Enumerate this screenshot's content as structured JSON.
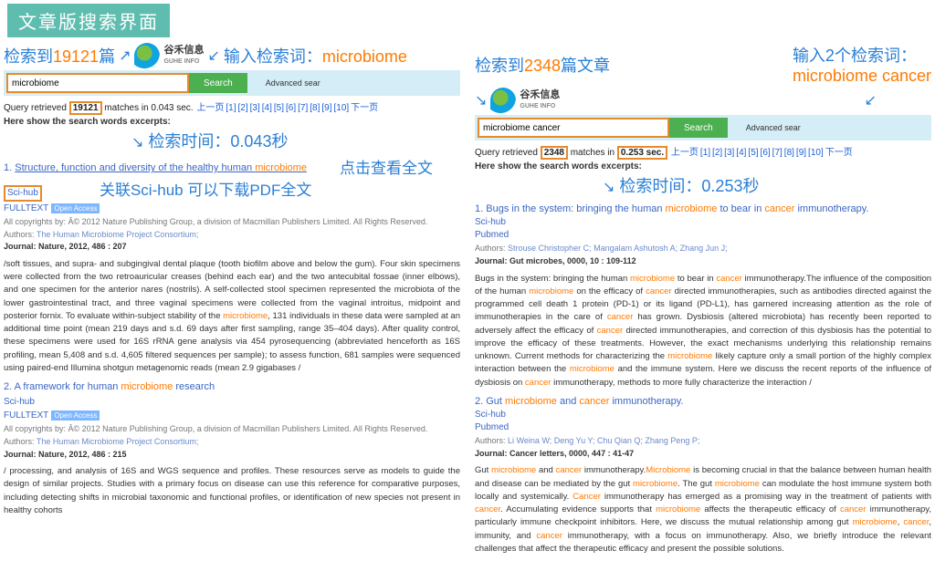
{
  "banner": "文章版搜索界面",
  "logo": {
    "cn": "谷禾信息",
    "en": "GUHE INFO"
  },
  "pagination_labels": {
    "prev": "上一页",
    "next": "下一页",
    "nums": [
      "[1]",
      "[2]",
      "[3]",
      "[4]",
      "[5]",
      "[6]",
      "[7]",
      "[8]",
      "[9]",
      "[10]"
    ]
  },
  "search_btn": "Search",
  "adv_search": "Advanced sear",
  "excerpt_head": "Here show the search words excerpts:",
  "left": {
    "anno_count_pre": "检索到",
    "count": "19121",
    "anno_count_suf": "篇",
    "anno_input": "输入检索词：",
    "query": "microbiome",
    "stat_pre": "Query retrieved ",
    "stat_mid": " matches in 0.043 sec.",
    "time_anno": "检索时间：0.043秒",
    "click_anno": "点击查看全文",
    "scihub_anno": "关联Sci-hub 可以下载PDF全文",
    "r1": {
      "num": "1.",
      "t1": "Structure, function and diversity of the healthy human ",
      "kw": "microbiome",
      "scihub": "Sci-hub",
      "ft": "FULLTEXT",
      "oa": "Open Access",
      "copy": "All copyrights by: Â© 2012 Nature Publishing Group, a division of Macmillan Publishers Limited. All Rights Reserved.",
      "auth_lbl": "Authors: ",
      "auth": "The Human Microbiome Project Consortium;",
      "jrn": "Journal: Nature, 2012, 486 : 207",
      "abs_a": "/soft tissues, and supra- and subgingival dental plaque (tooth biofilm above and below the gum). Four skin specimens were collected from the two retroauricular creases (behind each ear) and the two antecubital fossae (inner elbows), and one specimen for the anterior nares (nostrils). A self-collected stool specimen represented the microbiota of the lower gastrointestinal tract, and three vaginal specimens were collected from the vaginal introitus, midpoint and posterior fornix. To evaluate within-subject stability of the ",
      "abs_b": ", 131 individuals in these data were sampled at an additional time point (mean 219 days and s.d. 69 days after first sampling, range 35–404 days). After quality control, these specimens were used for 16S rRNA gene analysis via 454 pyrosequencing (abbreviated henceforth as 16S profiling, mean 5,408 and s.d. 4,605 filtered sequences per sample); to assess function, 681 samples were sequenced using paired-end Illumina shotgun metagenomic reads (mean 2.9 gigabases /"
    },
    "r2": {
      "num": "2.",
      "t1": "A framework for human ",
      "kw": "microbiome",
      "t2": " research",
      "scihub": "Sci-hub",
      "ft": "FULLTEXT",
      "oa": "Open Access",
      "copy": "All copyrights by: Â© 2012 Nature Publishing Group, a division of Macmillan Publishers Limited. All Rights Reserved.",
      "auth_lbl": "Authors: ",
      "auth": "The Human Microbiome Project Consortium;",
      "jrn": "Journal: Nature, 2012, 486 : 215",
      "abs": "/ processing, and analysis of 16S and WGS sequence and profiles. These resources serve as models to guide the design of similar projects. Studies with a primary focus on disease can use this reference for comparative purposes, including detecting shifts in microbial taxonomic and functional profiles, or identification of new species not present in healthy cohorts"
    }
  },
  "right": {
    "anno_count_pre": "检索到",
    "count": "2348",
    "anno_count_suf": "篇文章",
    "anno_input": "输入2个检索词：",
    "query": "microbiome cancer",
    "stat_pre": "Query retrieved ",
    "stat_mid": " matches in ",
    "stat_time": "0.253 sec.",
    "time_anno": "检索时间：0.253秒",
    "r1": {
      "num": "1.",
      "t1": "Bugs in the system: bringing the human ",
      "kw1": "microbiome",
      "t2": " to bear in ",
      "kw2": "cancer",
      "t3": " immunotherapy.",
      "scihub": "Sci-hub",
      "pubmed": "Pubmed",
      "auth_lbl": "Authors: ",
      "auth": "Strouse Christopher C; Mangalam Ashutosh A; Zhang Jun J;",
      "jrn": "Journal: Gut microbes, 0000, 10 : 109-112",
      "abs_a": "Bugs in the system: bringing the human ",
      "abs_b": " to bear in ",
      "abs_c": " immunotherapy.The influence of the composition of the human ",
      "abs_d": " on the efficacy of ",
      "abs_e": " directed immunotherapies, such as antibodies directed against the programmed cell death 1 protein (PD-1) or its ligand (PD-L1), has garnered increasing attention as the role of immunotherapies in the care of ",
      "abs_f": " has grown. Dysbiosis (altered microbiota) has recently been reported to adversely affect the efficacy of ",
      "abs_g": " directed immunotherapies, and correction of this dysbiosis has the potential to improve the efficacy of these treatments. However, the exact mechanisms underlying this relationship remains unknown. Current methods for characterizing the ",
      "abs_h": " likely capture only a small portion of the highly complex interaction between the ",
      "abs_i": " and the immune system. Here we discuss the recent reports of the influence of dysbiosis on ",
      "abs_j": " immunotherapy, methods to more fully characterize the interaction /"
    },
    "r2": {
      "num": "2.",
      "t1": "Gut ",
      "kw1": "microbiome",
      "t2": " and ",
      "kw2": "cancer",
      "t3": " immunotherapy.",
      "scihub": "Sci-hub",
      "pubmed": "Pubmed",
      "auth_lbl": "Authors: ",
      "auth": "Li Weina W; Deng Yu Y; Chu Qian Q; Zhang Peng P;",
      "jrn": "Journal: Cancer letters, 0000, 447 : 41-47",
      "abs_a": "Gut ",
      "abs_b": " and ",
      "abs_c": " immunotherapy.",
      "abs_d": " is becoming crucial in that the balance between human health and disease can be mediated by the gut ",
      "abs_e": ". The gut ",
      "abs_f": " can modulate the host immune system both locally and systemically. ",
      "abs_g": " immunotherapy has emerged as a promising way in the treatment of patients with ",
      "abs_h": ". Accumulating evidence supports that ",
      "abs_i": " affects the therapeutic efficacy of ",
      "abs_j": " immunotherapy, particularly immune checkpoint inhibitors. Here, we discuss the mutual relationship among gut ",
      "abs_k": ", ",
      "abs_l": ", immunity, and ",
      "abs_m": " immunotherapy, with a focus on immunotherapy. Also, we briefly introduce the relevant challenges that affect the therapeutic efficacy and present the possible solutions."
    }
  }
}
